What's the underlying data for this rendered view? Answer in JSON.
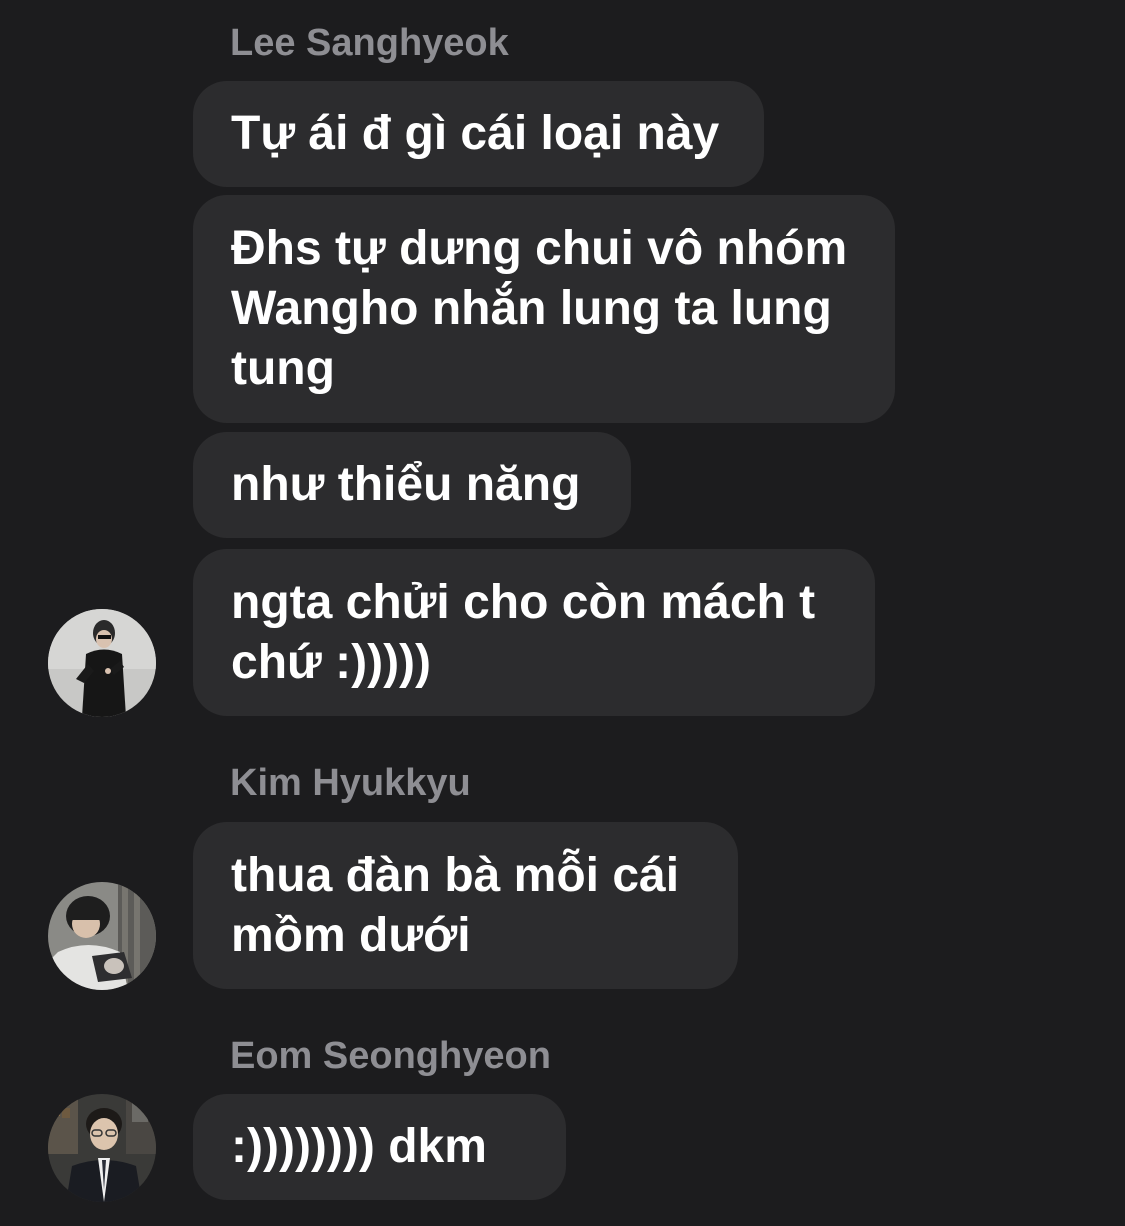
{
  "conversation": {
    "groups": [
      {
        "sender": "Lee Sanghyeok",
        "avatar_icon": "avatar-lee-sanghyeok",
        "messages": [
          "Tự ái đ gì cái loại này",
          "Đhs tự dưng chui vô nhóm Wangho nhắn lung ta lung tung",
          "như thiểu năng",
          "ngta chửi cho còn mách t chứ :)))))"
        ]
      },
      {
        "sender": "Kim Hyukkyu",
        "avatar_icon": "avatar-kim-hyukkyu",
        "messages": [
          "thua đàn bà mỗi cái mồm dưới"
        ]
      },
      {
        "sender": "Eom Seonghyeon",
        "avatar_icon": "avatar-eom-seonghyeon",
        "messages": [
          ":)))))))) dkm"
        ]
      }
    ]
  },
  "colors": {
    "background": "#1c1c1e",
    "bubble": "#2c2c2e",
    "sender_name": "#8e8e93",
    "message_text": "#ffffff"
  }
}
